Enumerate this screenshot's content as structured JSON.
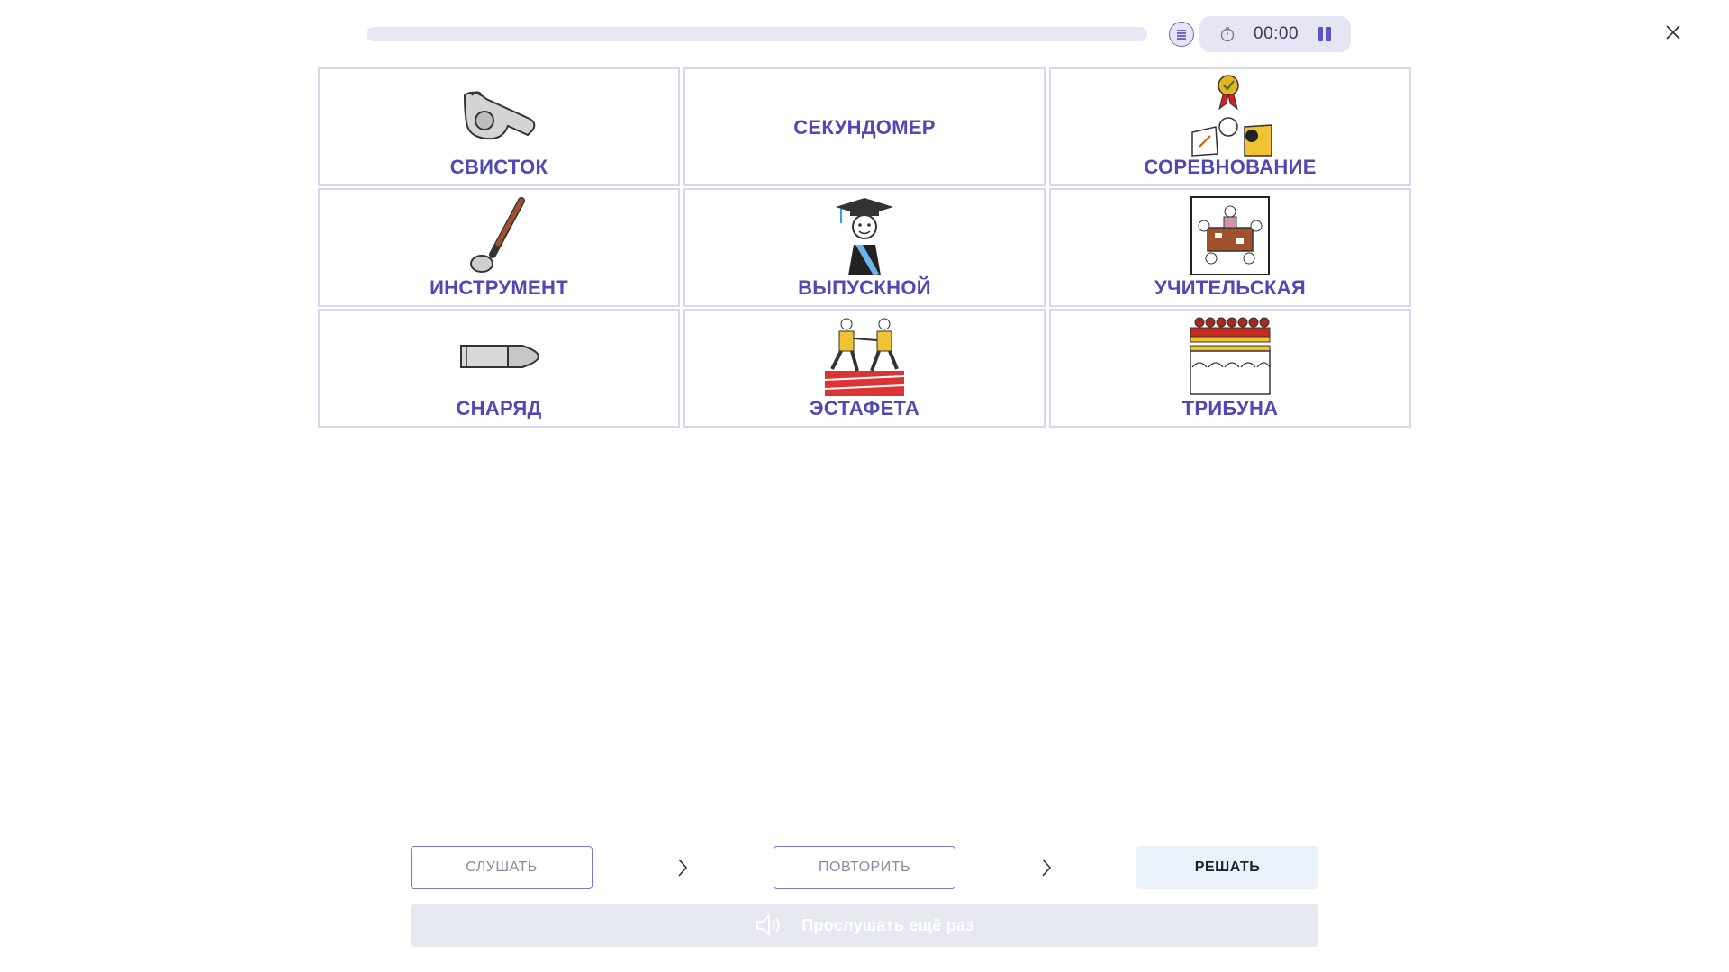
{
  "header": {
    "timer": "00:00"
  },
  "cards": [
    {
      "label": "СВИСТОК",
      "icon": "whistle-icon",
      "has_image": true
    },
    {
      "label": "СЕКУНДОМЕР",
      "icon": "",
      "has_image": false
    },
    {
      "label": "СОРЕВНОВАНИЕ",
      "icon": "competition-icon",
      "has_image": true
    },
    {
      "label": "ИНСТРУМЕНТ",
      "icon": "ladle-icon",
      "has_image": true
    },
    {
      "label": "ВЫПУСКНОЙ",
      "icon": "graduate-icon",
      "has_image": true
    },
    {
      "label": "УЧИТЕЛЬСКАЯ",
      "icon": "staff-room-icon",
      "has_image": true
    },
    {
      "label": "СНАРЯД",
      "icon": "bullet-icon",
      "has_image": true
    },
    {
      "label": "ЭСТАФЕТА",
      "icon": "relay-race-icon",
      "has_image": true
    },
    {
      "label": "ТРИБУНА",
      "icon": "grandstand-icon",
      "has_image": true
    }
  ],
  "steps": {
    "listen_label": "СЛУШАТЬ",
    "repeat_label": "ПОВТОРИТЬ",
    "solve_label": "РЕШАТЬ"
  },
  "replay": {
    "label": "Прослушать ещё раз",
    "icon": "speaker-icon"
  },
  "colors": {
    "accent": "#5147b5",
    "card_border": "#d9d7ee",
    "pill_bg": "#e6e5f6",
    "solve_bg": "#eaf1fb"
  }
}
